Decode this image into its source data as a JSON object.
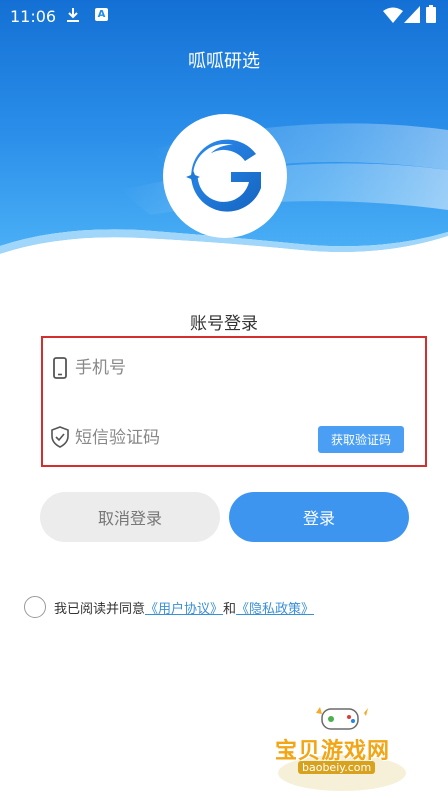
{
  "status_bar": {
    "time": "11:06",
    "a_badge": "A"
  },
  "header": {
    "app_title": "呱呱研选",
    "colors": {
      "gradient_top": "#1674d6",
      "gradient_mid": "#2a93ee",
      "highlight": "#9bd3fb"
    }
  },
  "login": {
    "title": "账号登录",
    "phone_placeholder": "手机号",
    "code_placeholder": "短信验证码",
    "get_code_label": "获取验证码",
    "cancel_label": "取消登录",
    "login_label": "登录"
  },
  "agreement": {
    "prefix": "我已阅读并同意",
    "user_agreement": "《用户协议》",
    "conjunction": "和",
    "privacy_policy": "《隐私政策》"
  },
  "watermark": {
    "title": "宝贝游戏网",
    "domain": "baobeiy.com"
  },
  "icons": [
    "download-icon",
    "a-badge-icon",
    "wifi-icon",
    "signal-icon",
    "battery-icon",
    "phone-icon",
    "shield-check-icon",
    "gamepad-icon"
  ]
}
